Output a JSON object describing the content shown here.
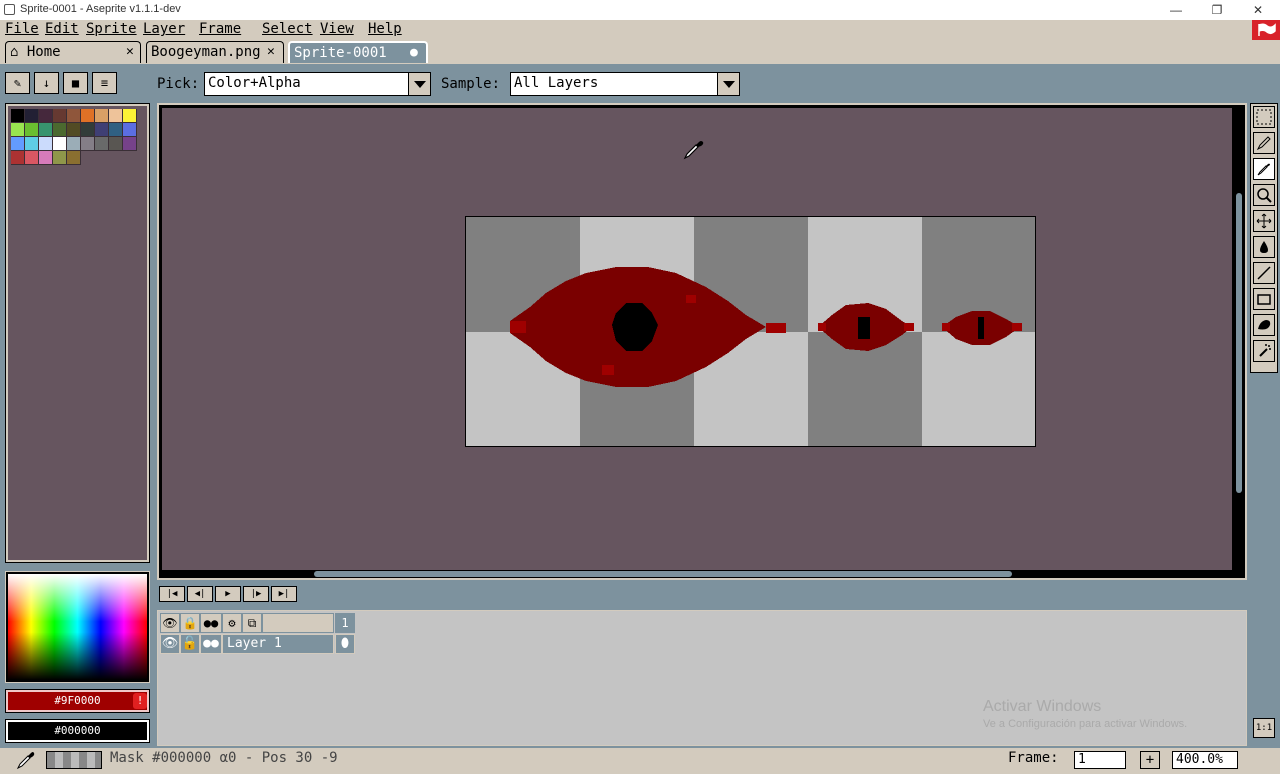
{
  "window": {
    "title": "Sprite-0001 - Aseprite v1.1.1-dev",
    "controls": [
      "—",
      "❐",
      "✕"
    ]
  },
  "menu": [
    "File",
    "Edit",
    "Sprite",
    "Layer",
    "Frame",
    "Select",
    "View",
    "Help"
  ],
  "tabs": [
    {
      "label": "Home",
      "icon": "home-icon",
      "close": "✕"
    },
    {
      "label": "Boogeyman.png",
      "close": "✕"
    },
    {
      "label": "Sprite-0001",
      "close": "●",
      "active": true
    }
  ],
  "toolbar": {
    "pick_label": "Pick:",
    "pick_value": "Color+Alpha",
    "sample_label": "Sample:",
    "sample_value": "All Layers",
    "mini_buttons": [
      "edit-icon",
      "down-arrow-icon",
      "save-icon",
      "menu-icon"
    ]
  },
  "palette": {
    "colors": [
      "#000000",
      "#222034",
      "#45283c",
      "#663931",
      "#8f563b",
      "#df7126",
      "#d9a066",
      "#eec39a",
      "#fbf236",
      "#99e550",
      "#6abe30",
      "#37946e",
      "#4b692f",
      "#524b24",
      "#323c39",
      "#3f3f74",
      "#306082",
      "#5b6ee1",
      "#639bff",
      "#5fcde4",
      "#cbdbfc",
      "#ffffff",
      "#9badb7",
      "#847e87",
      "#696a6a",
      "#595652",
      "#76428a",
      "#ac3232",
      "#d95763",
      "#d77bba",
      "#8f974a",
      "#8a6f30"
    ]
  },
  "colors": {
    "foreground": "#9F0000",
    "background": "#000000",
    "warning": "!"
  },
  "anim_buttons": [
    "|◀",
    "◀|",
    "▶",
    "|▶",
    "▶|"
  ],
  "timeline": {
    "frame_header": "1",
    "layer_name": "Layer 1",
    "header_icons": [
      "eye-icon",
      "lock-icon",
      "onion-icon",
      "gear-icon",
      "link-icon"
    ]
  },
  "watermark": {
    "line1": "Activar Windows",
    "line2": "Ve a Configuración para activar Windows."
  },
  "status": {
    "text": "Mask #000000 α0 - Pos 30 -9",
    "frame_label": "Frame:",
    "frame_value": "1",
    "plus": "+",
    "zoom": "400.0%",
    "one_one": "1:1"
  }
}
